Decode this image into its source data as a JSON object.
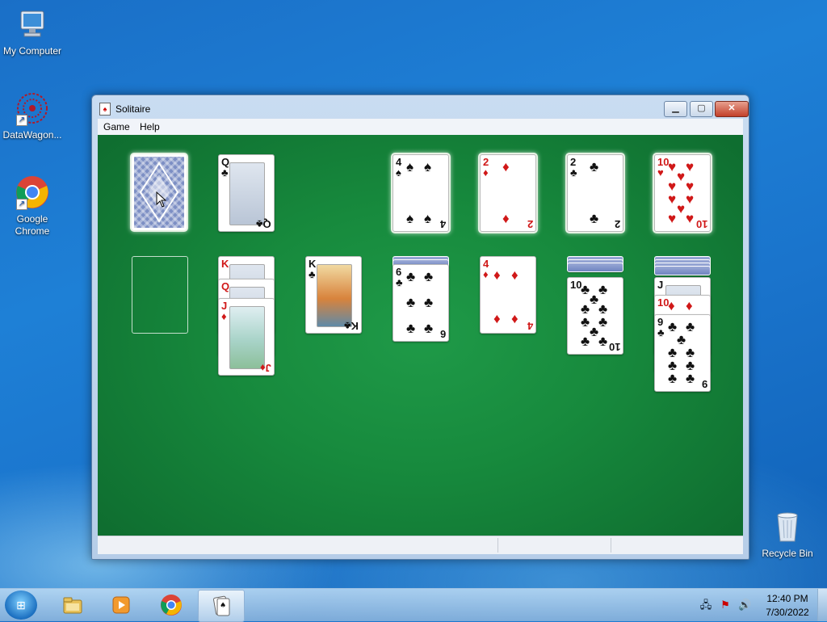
{
  "desktop": {
    "icons": [
      {
        "label": "My Computer"
      },
      {
        "label": "DataWagon..."
      },
      {
        "label": "Google Chrome"
      },
      {
        "label": "Recycle Bin"
      }
    ]
  },
  "window": {
    "title": "Solitaire",
    "menu": [
      "Game",
      "Help"
    ],
    "controls": {
      "minimize": "▁",
      "maximize": "▢",
      "close": "✕"
    }
  },
  "game": {
    "stock": {
      "face_down": true
    },
    "waste": {
      "rank": "Q",
      "suit": "♣"
    },
    "foundations": [
      {
        "rank": "4",
        "suit": "♠"
      },
      {
        "rank": "2",
        "suit": "♦"
      },
      {
        "rank": "2",
        "suit": "♣"
      },
      {
        "rank": "10",
        "suit": "♥"
      }
    ],
    "tableau": [
      {
        "empty": true,
        "cards": []
      },
      {
        "cards": [
          {
            "rank": "K",
            "suit": "♥"
          },
          {
            "rank": "Q",
            "suit": "♥"
          },
          {
            "rank": "J",
            "suit": "♦"
          }
        ]
      },
      {
        "cards": [
          {
            "rank": "K",
            "suit": "♣"
          }
        ]
      },
      {
        "face_down": 2,
        "cards": [
          {
            "rank": "6",
            "suit": "♣"
          }
        ]
      },
      {
        "cards": [
          {
            "rank": "4",
            "suit": "♦"
          }
        ]
      },
      {
        "face_down": 3,
        "cards": [
          {
            "rank": "10",
            "suit": "♣"
          }
        ]
      },
      {
        "face_down": 4,
        "cards": [
          {
            "rank": "J",
            "suit": "♥"
          },
          {
            "rank": "10",
            "suit": "♦"
          },
          {
            "rank": "9",
            "suit": "♣"
          }
        ]
      }
    ]
  },
  "taskbar": {
    "start": "⊞",
    "pinned": [
      "explorer-icon",
      "media-player-icon",
      "chrome-icon",
      "solitaire-icon"
    ],
    "clock": {
      "time": "12:40 PM",
      "date": "7/30/2022"
    }
  },
  "colors": {
    "felt": "#178a3d",
    "red_suit": "#d01818",
    "black_suit": "#111111",
    "desktop": "#1e80d6"
  }
}
